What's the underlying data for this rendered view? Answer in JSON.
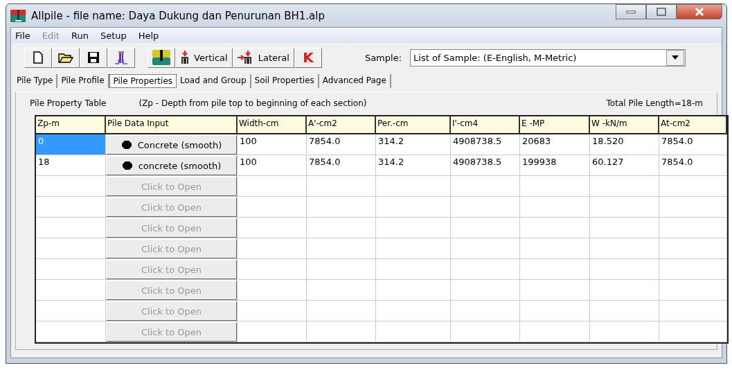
{
  "window": {
    "title": "Allpile - file name: Daya Dukung dan Penurunan BH1.alp"
  },
  "menu": [
    {
      "label": "File",
      "disabled": false
    },
    {
      "label": "Edit",
      "disabled": true
    },
    {
      "label": "Run",
      "disabled": false
    },
    {
      "label": "Setup",
      "disabled": false
    },
    {
      "label": "Help",
      "disabled": false
    }
  ],
  "toolbar": {
    "buttons": [
      {
        "kind": "new"
      },
      {
        "kind": "open"
      },
      {
        "kind": "save"
      },
      {
        "kind": "pile"
      },
      {
        "kind": "soil"
      },
      {
        "kind": "vertical",
        "label": "Vertical"
      },
      {
        "kind": "lateral",
        "label": "Lateral"
      },
      {
        "kind": "k",
        "label": "K"
      }
    ],
    "sample_label": "Sample:",
    "sample_value": "List of Sample:  (E-English, M-Metric)"
  },
  "tabs": [
    {
      "label": "Pile Type",
      "selected": false
    },
    {
      "label": "Pile Profile",
      "selected": false
    },
    {
      "label": "Pile Properties",
      "selected": true
    },
    {
      "label": "Load and Group",
      "selected": false
    },
    {
      "label": "Soil Properties",
      "selected": false
    },
    {
      "label": "Advanced Page",
      "selected": false
    }
  ],
  "table_title": "Pile Property Table",
  "table_note": "(Zp - Depth from pile top to beginning of each section)",
  "total": "Total Pile Length=18-m",
  "table": {
    "columns": [
      "Zp-m",
      "Pile Data Input",
      "Width-cm",
      "A'-cm2",
      "Per.-cm",
      "I'-cm4",
      "E -MP",
      "W -kN/m",
      "At-cm2"
    ],
    "rows": [
      {
        "zp": "0",
        "selected": true,
        "input": "Concrete (smooth)",
        "disabled": false,
        "cells": [
          "100",
          "7854.0",
          "314.2",
          "4908738.5",
          "20683",
          "18.520",
          "7854.0"
        ]
      },
      {
        "zp": "18",
        "selected": false,
        "input": "concrete (smooth)",
        "disabled": false,
        "cells": [
          "100",
          "7854.0",
          "314.2",
          "4908738.5",
          "199938",
          "60.127",
          "7854.0"
        ]
      },
      {
        "selected": false,
        "input": "Click to Open",
        "disabled": true
      },
      {
        "selected": false,
        "input": "Click to Open",
        "disabled": true
      },
      {
        "selected": false,
        "input": "Click to Open",
        "disabled": true
      },
      {
        "selected": false,
        "input": "Click to Open",
        "disabled": true
      },
      {
        "selected": false,
        "input": "Click to Open",
        "disabled": true
      },
      {
        "selected": false,
        "input": "Click to Open",
        "disabled": true
      },
      {
        "selected": false,
        "input": "Click to Open",
        "disabled": true
      },
      {
        "selected": false,
        "input": "Click to Open",
        "disabled": true
      }
    ]
  }
}
